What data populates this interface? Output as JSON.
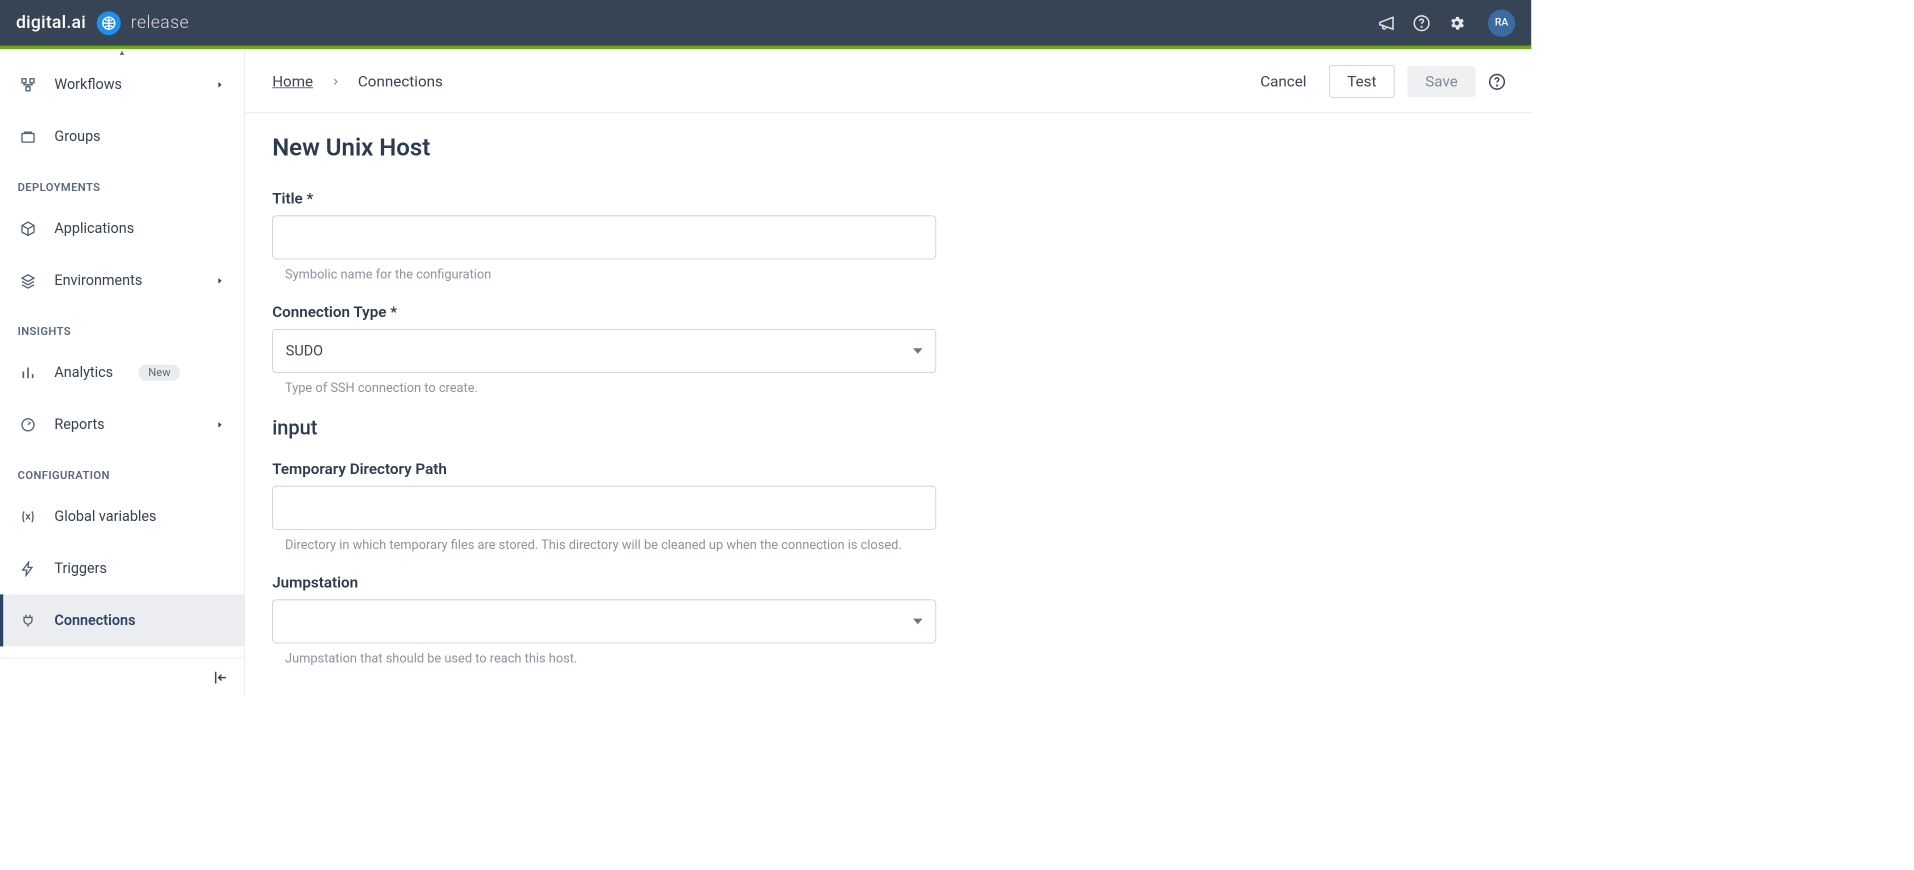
{
  "header": {
    "brand": "digital.ai",
    "product": "release",
    "avatar_initials": "RA"
  },
  "sidebar": {
    "items": {
      "workflows": "Workflows",
      "groups": "Groups",
      "applications": "Applications",
      "environments": "Environments",
      "analytics": "Analytics",
      "analytics_badge": "New",
      "reports": "Reports",
      "global_vars": "Global variables",
      "triggers": "Triggers",
      "connections": "Connections"
    },
    "sections": {
      "deployments": "DEPLOYMENTS",
      "insights": "INSIGHTS",
      "configuration": "CONFIGURATION"
    }
  },
  "breadcrumb": {
    "home": "Home",
    "current": "Connections"
  },
  "actions": {
    "cancel": "Cancel",
    "test": "Test",
    "save": "Save"
  },
  "form": {
    "title": "New Unix Host",
    "fields": {
      "title_label": "Title *",
      "title_hint": "Symbolic name for the configuration",
      "conn_type_label": "Connection Type *",
      "conn_type_value": "SUDO",
      "conn_type_hint": "Type of SSH connection to create.",
      "section_input": "input",
      "tmp_dir_label": "Temporary Directory Path",
      "tmp_dir_hint": "Directory in which temporary files are stored. This directory will be cleaned up when the connection is closed.",
      "jump_label": "Jumpstation",
      "jump_hint": "Jumpstation that should be used to reach this host."
    }
  }
}
